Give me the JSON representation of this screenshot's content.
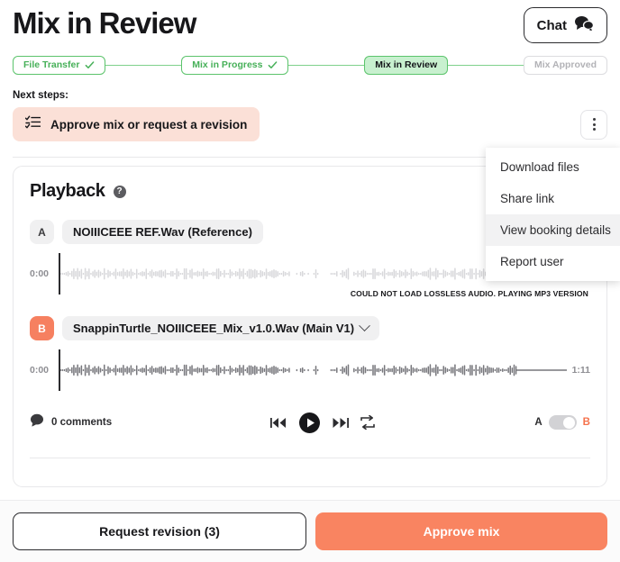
{
  "header": {
    "title": "Mix in Review",
    "chat_label": "Chat"
  },
  "stepper": {
    "steps": [
      {
        "label": "File Transfer",
        "state": "done"
      },
      {
        "label": "Mix in Progress",
        "state": "done"
      },
      {
        "label": "Mix in Review",
        "state": "current"
      },
      {
        "label": "Mix Approved",
        "state": "todo"
      }
    ]
  },
  "next_steps": {
    "label": "Next steps:",
    "action_label": "Approve mix or request a revision"
  },
  "menu": {
    "items": [
      {
        "label": "Download files",
        "hovered": false
      },
      {
        "label": "Share link",
        "hovered": false
      },
      {
        "label": "View booking details",
        "hovered": true
      },
      {
        "label": "Report user",
        "hovered": false
      }
    ]
  },
  "playback": {
    "title": "Playback",
    "help_glyph": "?",
    "warning": "COULD NOT LOAD LOSSLESS AUDIO. PLAYING MP3 VERSION",
    "tracks": [
      {
        "badge": "A",
        "name": "NOIIICEEE REF.Wav (Reference)",
        "start_time": "0:00",
        "end_time": "",
        "has_chevron": false,
        "active": false
      },
      {
        "badge": "B",
        "name": "SnappinTurtle_NOIIICEEE_Mix_v1.0.Wav (Main V1)",
        "start_time": "0:00",
        "end_time": "1:11",
        "has_chevron": true,
        "active": true
      }
    ],
    "controls": {
      "comments_label": "0 comments",
      "ab_left": "A",
      "ab_right": "B",
      "toggle_position": "right"
    }
  },
  "footer": {
    "secondary_label": "Request revision (3)",
    "primary_label": "Approve mix"
  },
  "colors": {
    "accent_orange": "#f98461",
    "step_green": "#5cc46c",
    "step_green_fill": "#c8f0cf",
    "next_peach": "#fbe0d7"
  }
}
